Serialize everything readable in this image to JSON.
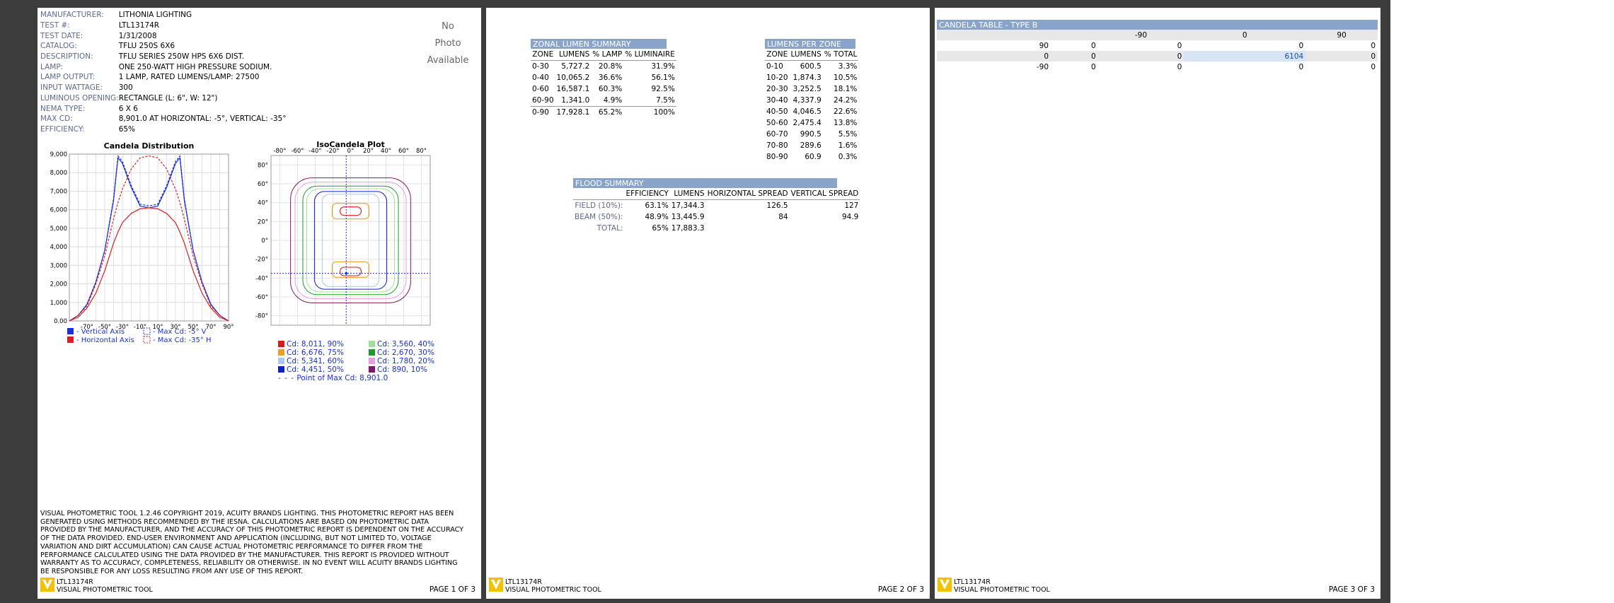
{
  "page1": {
    "info": [
      {
        "key": "MANUFACTURER:",
        "value": "LITHONIA LIGHTING"
      },
      {
        "key": "TEST #:",
        "value": "LTL13174R"
      },
      {
        "key": "TEST DATE:",
        "value": "1/31/2008"
      },
      {
        "key": "CATALOG:",
        "value": "TFLU 250S 6X6"
      },
      {
        "key": "DESCRIPTION:",
        "value": "TFLU SERIES 250W HPS 6X6 DIST."
      },
      {
        "key": "LAMP:",
        "value": "ONE 250-WATT HIGH PRESSURE SODIUM."
      },
      {
        "key": "LAMP OUTPUT:",
        "value": "1 LAMP, RATED LUMENS/LAMP: 27500"
      },
      {
        "key": "INPUT WATTAGE:",
        "value": "300"
      },
      {
        "key": "LUMINOUS OPENING:",
        "value": "RECTANGLE (L: 6\", W: 12\")"
      },
      {
        "key": "NEMA TYPE:",
        "value": "6 X 6"
      },
      {
        "key": "MAX CD:",
        "value": "8,901.0 AT HORIZONTAL: -5°, VERTICAL: -35°"
      },
      {
        "key": "EFFICIENCY:",
        "value": "65%"
      }
    ],
    "photo": [
      "No",
      "Photo",
      "Available"
    ],
    "candela_chart": {
      "title": "Candela Distribution",
      "y_ticks": [
        "9,000",
        "8,000",
        "7,000",
        "6,000",
        "5,000",
        "4,000",
        "3,000",
        "2,000",
        "1,000",
        "0.00"
      ],
      "x_ticks": [
        "-70°",
        "-50°",
        "-30°",
        "-10°",
        "10°",
        "30°",
        "50°",
        "70°",
        "90°"
      ],
      "legend": [
        {
          "label": "- Vertical Axis",
          "color": "#1a2fd6",
          "style": "solid"
        },
        {
          "label": "- Max Cd: -5° V",
          "color": "#1a2fd6",
          "style": "dashed"
        },
        {
          "label": "- Horizontal Axis",
          "color": "#d62020",
          "style": "solid"
        },
        {
          "label": "- Max Cd: -35° H",
          "color": "#d62020",
          "style": "dashed"
        }
      ]
    },
    "iso_chart": {
      "title": "IsoCandela Plot",
      "x_ticks": [
        "-80°",
        "-60°",
        "-40°",
        "-20°",
        "0°",
        "20°",
        "40°",
        "60°",
        "80°"
      ],
      "y_ticks": [
        "80°",
        "60°",
        "40°",
        "20°",
        "0°",
        "-20°",
        "-40°",
        "-60°",
        "-80°"
      ],
      "legend": [
        {
          "label": "Cd: 8,011, 90%",
          "color": "#e01818"
        },
        {
          "label": "Cd: 3,560, 40%",
          "color": "#9ee09a"
        },
        {
          "label": "Cd: 6,676, 75%",
          "color": "#f0a020"
        },
        {
          "label": "Cd: 2,670, 30%",
          "color": "#1e9a2a"
        },
        {
          "label": "Cd: 5,341, 60%",
          "color": "#a8c8f0"
        },
        {
          "label": "Cd: 1,780, 20%",
          "color": "#e8a0e0"
        },
        {
          "label": "Cd: 4,451, 50%",
          "color": "#1020c8"
        },
        {
          "label": "Cd: 890, 10%",
          "color": "#801868"
        }
      ],
      "max_point": "Point of Max Cd: 8,901.0"
    },
    "disclaimer": "VISUAL PHOTOMETRIC TOOL 1.2.46 COPYRIGHT 2019, ACUITY BRANDS LIGHTING. THIS PHOTOMETRIC REPORT HAS BEEN GENERATED USING METHODS RECOMMENDED BY THE IESNA. CALCULATIONS ARE BASED ON PHOTOMETRIC DATA PROVIDED BY THE MANUFACTURER, AND THE ACCURACY OF THIS PHOTOMETRIC REPORT IS DEPENDENT ON THE ACCURACY OF THE DATA PROVIDED. END-USER ENVIRONMENT AND APPLICATION (INCLUDING, BUT NOT LIMITED TO, VOLTAGE VARIATION AND DIRT ACCUMULATION) CAN CAUSE ACTUAL PHOTOMETRIC PERFORMANCE TO DIFFER FROM THE PERFORMANCE CALCULATED USING THE DATA PROVIDED BY THE MANUFACTURER. THIS REPORT IS PROVIDED WITHOUT WARRANTY AS TO ACCURACY, COMPLETENESS, RELIABILITY OR OTHERWISE. IN NO EVENT WILL ACUITY BRANDS LIGHTING BE RESPONSIBLE FOR ANY LOSS RESULTING FROM ANY USE OF THIS REPORT.",
    "page_label": "PAGE 1 OF 3"
  },
  "page2": {
    "zonal": {
      "title": "ZONAL LUMEN SUMMARY",
      "headers": [
        "ZONE",
        "LUMENS",
        "% LAMP",
        "% LUMINAIRE"
      ],
      "rows": [
        [
          "0-30",
          "5,727.2",
          "20.8%",
          "31.9%"
        ],
        [
          "0-40",
          "10,065.2",
          "36.6%",
          "56.1%"
        ],
        [
          "0-60",
          "16,587.1",
          "60.3%",
          "92.5%"
        ],
        [
          "60-90",
          "1,341.0",
          "4.9%",
          "7.5%"
        ],
        [
          "0-90",
          "17,928.1",
          "65.2%",
          "100%"
        ]
      ]
    },
    "per_zone": {
      "title": "LUMENS PER ZONE",
      "headers": [
        "ZONE",
        "LUMENS",
        "% TOTAL"
      ],
      "rows": [
        [
          "0-10",
          "600.5",
          "3.3%"
        ],
        [
          "10-20",
          "1,874.3",
          "10.5%"
        ],
        [
          "20-30",
          "3,252.5",
          "18.1%"
        ],
        [
          "30-40",
          "4,337.9",
          "24.2%"
        ],
        [
          "40-50",
          "4,046.5",
          "22.6%"
        ],
        [
          "50-60",
          "2,475.4",
          "13.8%"
        ],
        [
          "60-70",
          "990.5",
          "5.5%"
        ],
        [
          "70-80",
          "289.6",
          "1.6%"
        ],
        [
          "80-90",
          "60.9",
          "0.3%"
        ]
      ]
    },
    "flood": {
      "title": "FLOOD SUMMARY",
      "headers": [
        "",
        "EFFICIENCY",
        "LUMENS",
        "HORIZONTAL SPREAD",
        "VERTICAL SPREAD"
      ],
      "rows": [
        [
          "FIELD (10%):",
          "63.1%",
          "17,344.3",
          "126.5",
          "127"
        ],
        [
          "BEAM (50%):",
          "48.9%",
          "13,445.9",
          "84",
          "94.9"
        ],
        [
          "TOTAL:",
          "65%",
          "17,883.3",
          "",
          ""
        ]
      ]
    },
    "page_label": "PAGE 2 OF 3"
  },
  "page3": {
    "title": "CANDELA TABLE - TYPE B",
    "col_headers": [
      "",
      "-90",
      "0",
      "90"
    ],
    "rows": [
      [
        "90",
        "0",
        "0",
        "0",
        "0"
      ],
      [
        "0",
        "0",
        "0",
        "6104",
        "0"
      ],
      [
        "-90",
        "0",
        "0",
        "0",
        "0"
      ]
    ],
    "page_label": "PAGE 3 OF 3"
  },
  "footer": {
    "test": "LTL13174R",
    "tool": "VISUAL PHOTOMETRIC TOOL"
  },
  "chart_data": [
    {
      "type": "line",
      "title": "Candela Distribution",
      "x": [
        -90,
        -80,
        -70,
        -60,
        -50,
        -40,
        -35,
        -30,
        -20,
        -10,
        0,
        10,
        20,
        30,
        35,
        40,
        50,
        60,
        70,
        80,
        90
      ],
      "ylim": [
        0,
        9000
      ],
      "series": [
        {
          "name": "Vertical Axis",
          "values": [
            0,
            300,
            900,
            2100,
            3800,
            6500,
            8800,
            8500,
            7200,
            6200,
            6100,
            6200,
            7200,
            8500,
            8800,
            6500,
            3800,
            2100,
            900,
            300,
            0
          ]
        },
        {
          "name": "Max Cd: -5° V",
          "values": [
            0,
            300,
            900,
            2100,
            3800,
            6600,
            8900,
            8600,
            7300,
            6300,
            6200,
            6300,
            7300,
            8600,
            8900,
            6600,
            3800,
            2100,
            900,
            300,
            0
          ]
        },
        {
          "name": "Horizontal Axis",
          "values": [
            0,
            200,
            700,
            1500,
            2700,
            4200,
            4800,
            5300,
            5800,
            6050,
            6104,
            6050,
            5800,
            5300,
            4800,
            4200,
            2700,
            1500,
            700,
            200,
            0
          ]
        },
        {
          "name": "Max Cd: -35° H",
          "values": [
            0,
            300,
            800,
            2000,
            3500,
            5500,
            6400,
            7100,
            8200,
            8800,
            8901,
            8800,
            8200,
            7100,
            6400,
            5500,
            3500,
            2000,
            800,
            300,
            0
          ]
        }
      ]
    }
  ]
}
